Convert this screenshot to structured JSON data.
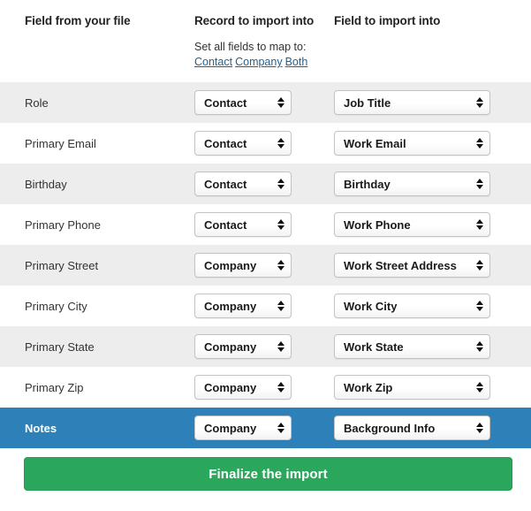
{
  "header": {
    "col_file_field": "Field from your file",
    "col_record": "Record to import into",
    "col_field": "Field to import into",
    "set_all_label": "Set all fields to map to:",
    "set_all_links": [
      {
        "label": "Contact"
      },
      {
        "label": "Company"
      },
      {
        "label": "Both"
      }
    ]
  },
  "mappings": [
    {
      "source_field": "Role",
      "record": "Contact",
      "target_field": "Job Title",
      "highlighted": false
    },
    {
      "source_field": "Primary Email",
      "record": "Contact",
      "target_field": "Work Email",
      "highlighted": false
    },
    {
      "source_field": "Birthday",
      "record": "Contact",
      "target_field": "Birthday",
      "highlighted": false
    },
    {
      "source_field": "Primary Phone",
      "record": "Contact",
      "target_field": "Work Phone",
      "highlighted": false
    },
    {
      "source_field": "Primary Street",
      "record": "Company",
      "target_field": "Work Street Address",
      "highlighted": false
    },
    {
      "source_field": "Primary City",
      "record": "Company",
      "target_field": "Work City",
      "highlighted": false
    },
    {
      "source_field": "Primary State",
      "record": "Company",
      "target_field": "Work State",
      "highlighted": false
    },
    {
      "source_field": "Primary Zip",
      "record": "Company",
      "target_field": "Work Zip",
      "highlighted": false
    },
    {
      "source_field": "Notes",
      "record": "Company",
      "target_field": "Background Info",
      "highlighted": true
    }
  ],
  "footer": {
    "finalize_label": "Finalize the import"
  },
  "colors": {
    "row_alt_background": "#ededed",
    "row_highlight_background": "#2e80b8",
    "link": "#2b5f86",
    "primary_button": "#2aa75c"
  }
}
